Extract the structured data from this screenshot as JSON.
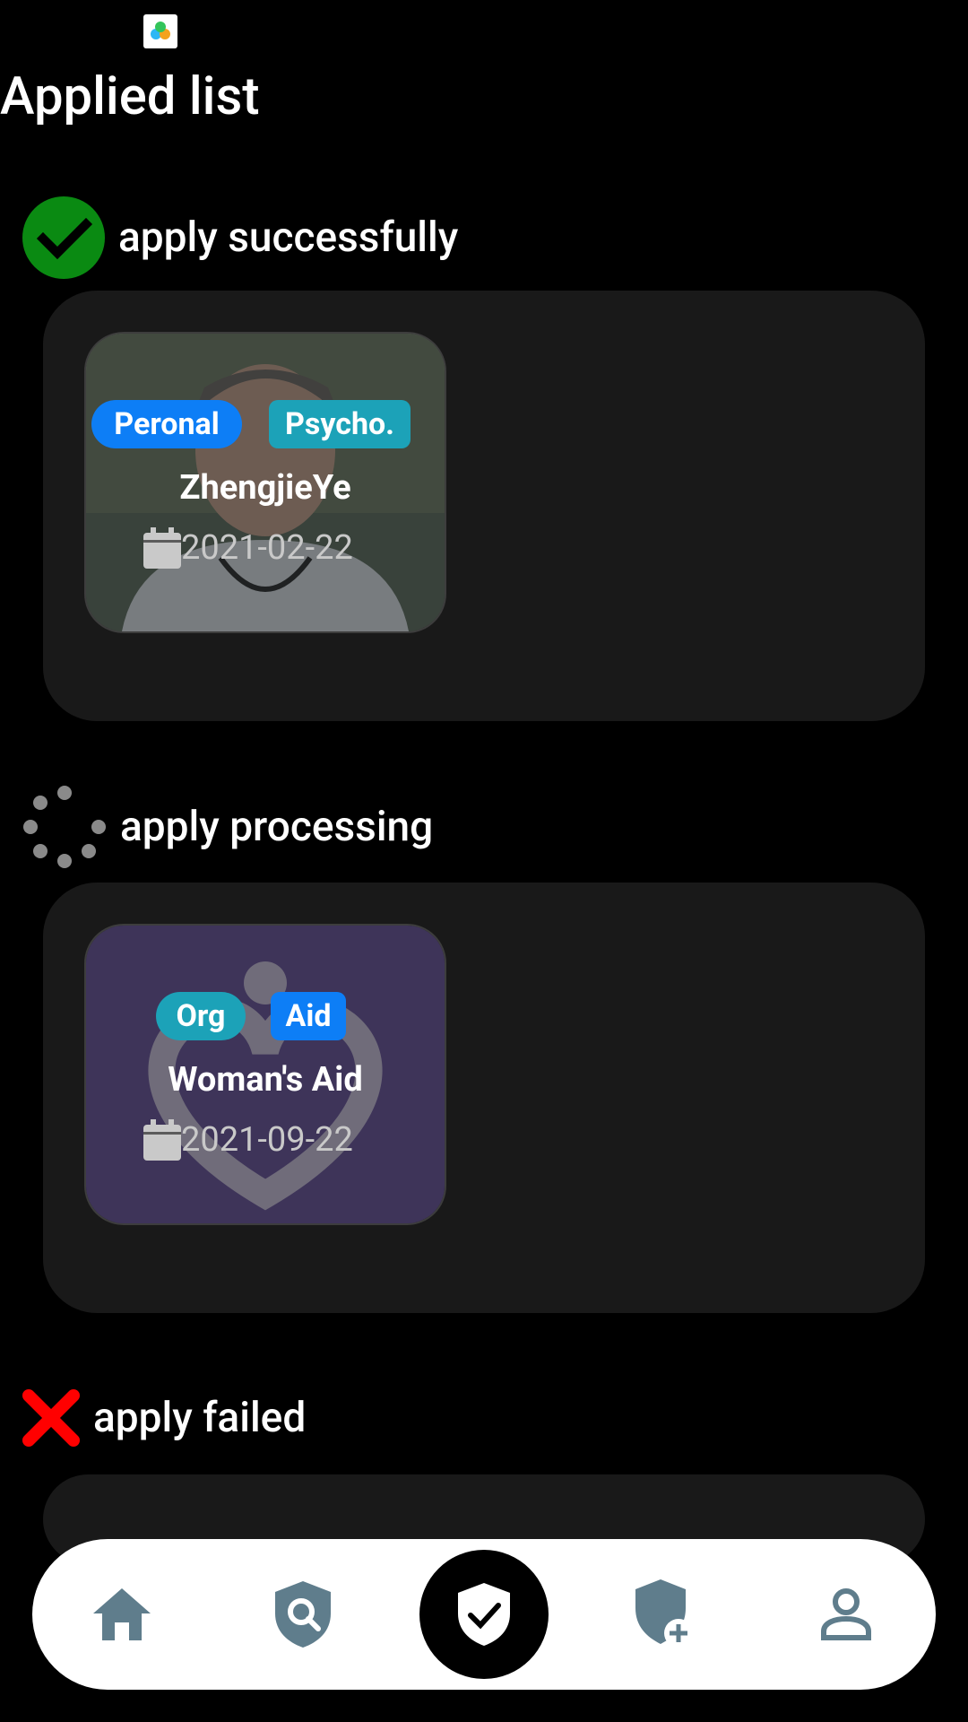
{
  "page": {
    "title": "Applied list"
  },
  "sections": {
    "success": {
      "label": "apply successfully",
      "card": {
        "tags": [
          "Peronal",
          "Psycho."
        ],
        "name": "ZhengjieYe",
        "date": "2021-02-22"
      }
    },
    "processing": {
      "label": "apply processing",
      "card": {
        "tags": [
          "Org",
          "Aid"
        ],
        "name": "Woman's Aid",
        "date": "2021-09-22"
      }
    },
    "failed": {
      "label": "apply failed"
    }
  },
  "nav": {
    "items": [
      "home-icon",
      "shield-search-icon",
      "shield-check-icon",
      "shield-add-icon",
      "profile-icon"
    ],
    "active_index": 2
  },
  "colors": {
    "background": "#000000",
    "panel": "#191919",
    "tag_blue": "#0d7ef6",
    "tag_teal": "#1ca2b8",
    "success_green": "#0a8a12",
    "failed_red": "#ff0000",
    "nav_icon": "#5f7d8c",
    "processing_card_bg": "#3f365a"
  }
}
